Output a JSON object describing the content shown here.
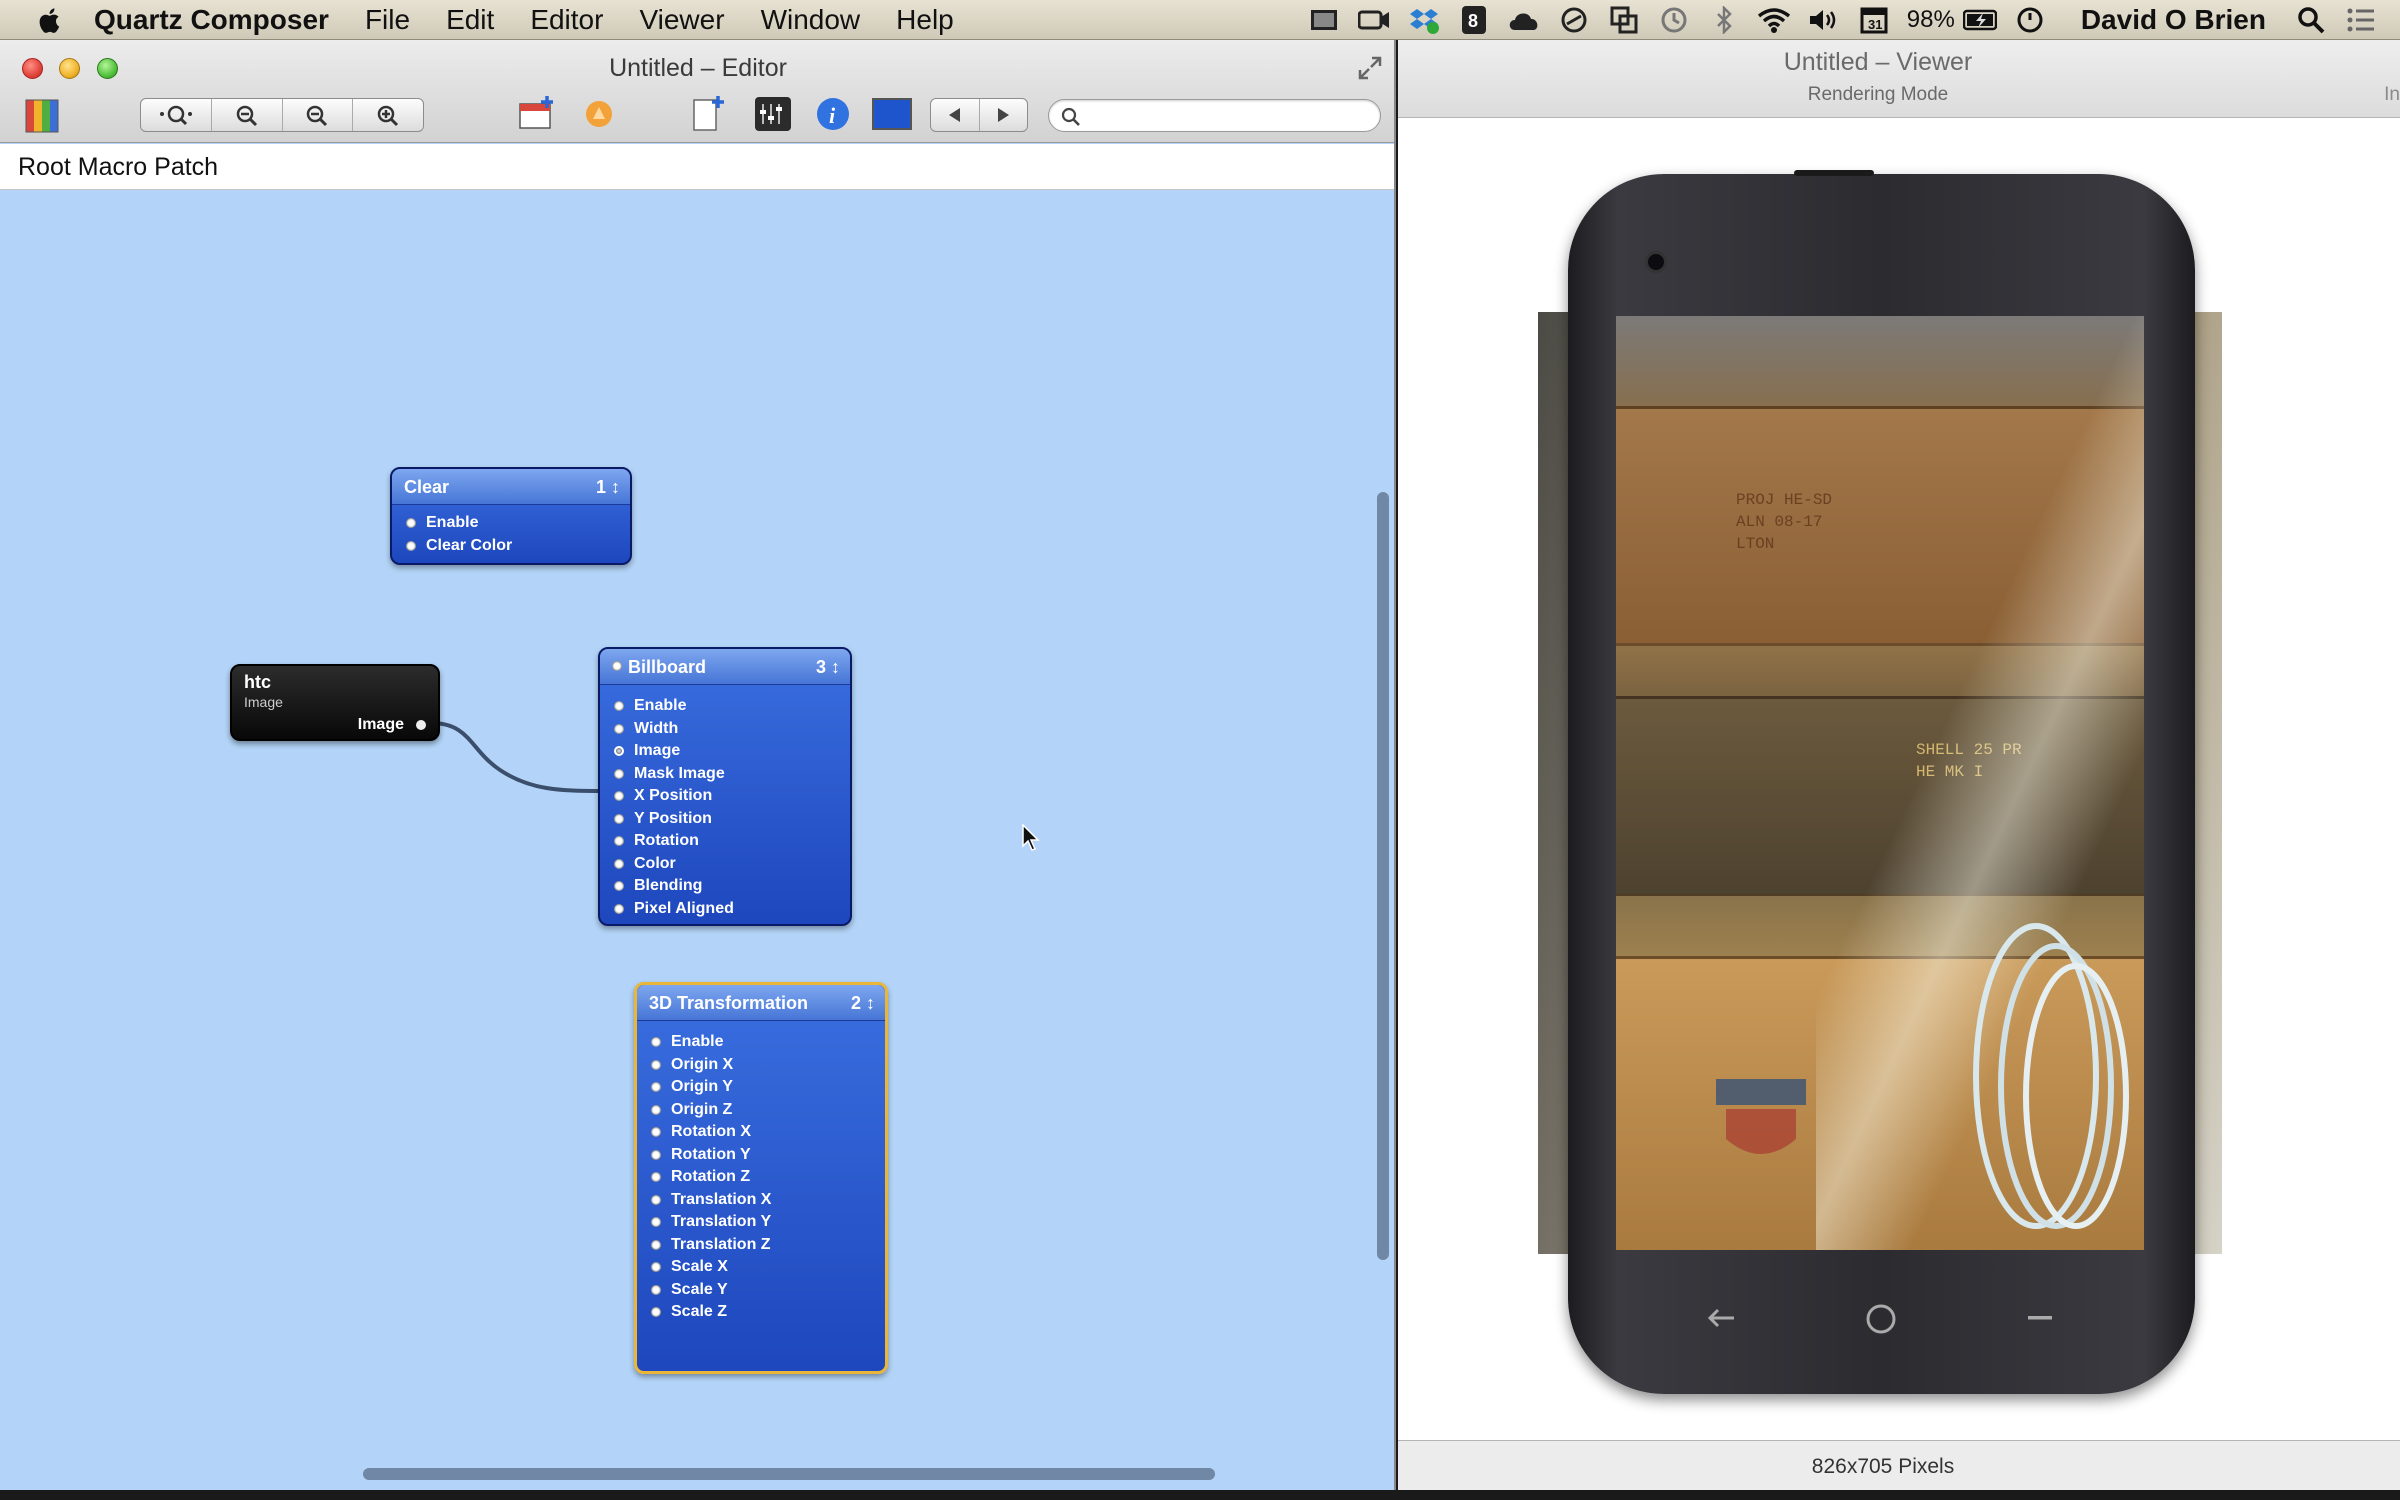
{
  "menubar": {
    "app_name": "Quartz Composer",
    "items": [
      "File",
      "Edit",
      "Editor",
      "Viewer",
      "Window",
      "Help"
    ],
    "battery": "98%",
    "user": "David O Brien"
  },
  "editor": {
    "title": "Untitled – Editor",
    "breadcrumb": "Root Macro Patch",
    "search": {
      "value": "",
      "placeholder": ""
    },
    "patches": {
      "clear": {
        "title": "Clear",
        "count": "1 ↕",
        "ports": [
          "Enable",
          "Clear Color"
        ]
      },
      "htc": {
        "title": "htc",
        "subtitle": "Image",
        "output": "Image"
      },
      "billboard": {
        "title": "Billboard",
        "count": "3 ↕",
        "ports": [
          "Enable",
          "Width",
          "Image",
          "Mask Image",
          "X Position",
          "Y Position",
          "Rotation",
          "Color",
          "Blending",
          "Pixel Aligned"
        ]
      },
      "transform3d": {
        "title": "3D Transformation",
        "count": "2 ↕",
        "ports": [
          "Enable",
          "Origin X",
          "Origin Y",
          "Origin Z",
          "Rotation X",
          "Rotation Y",
          "Rotation Z",
          "Translation X",
          "Translation Y",
          "Translation Z",
          "Scale X",
          "Scale Y",
          "Scale Z"
        ]
      }
    }
  },
  "viewer": {
    "title": "Untitled – Viewer",
    "mode_label": "Rendering Mode",
    "edge_label": "In",
    "dimensions": "826x705 Pixels"
  },
  "colors": {
    "canvas": "#b3d4f8",
    "patch_blue": "#2a58cf",
    "patch_selected_border": "#e9b63a",
    "image_patch": "#1a1a1a"
  }
}
